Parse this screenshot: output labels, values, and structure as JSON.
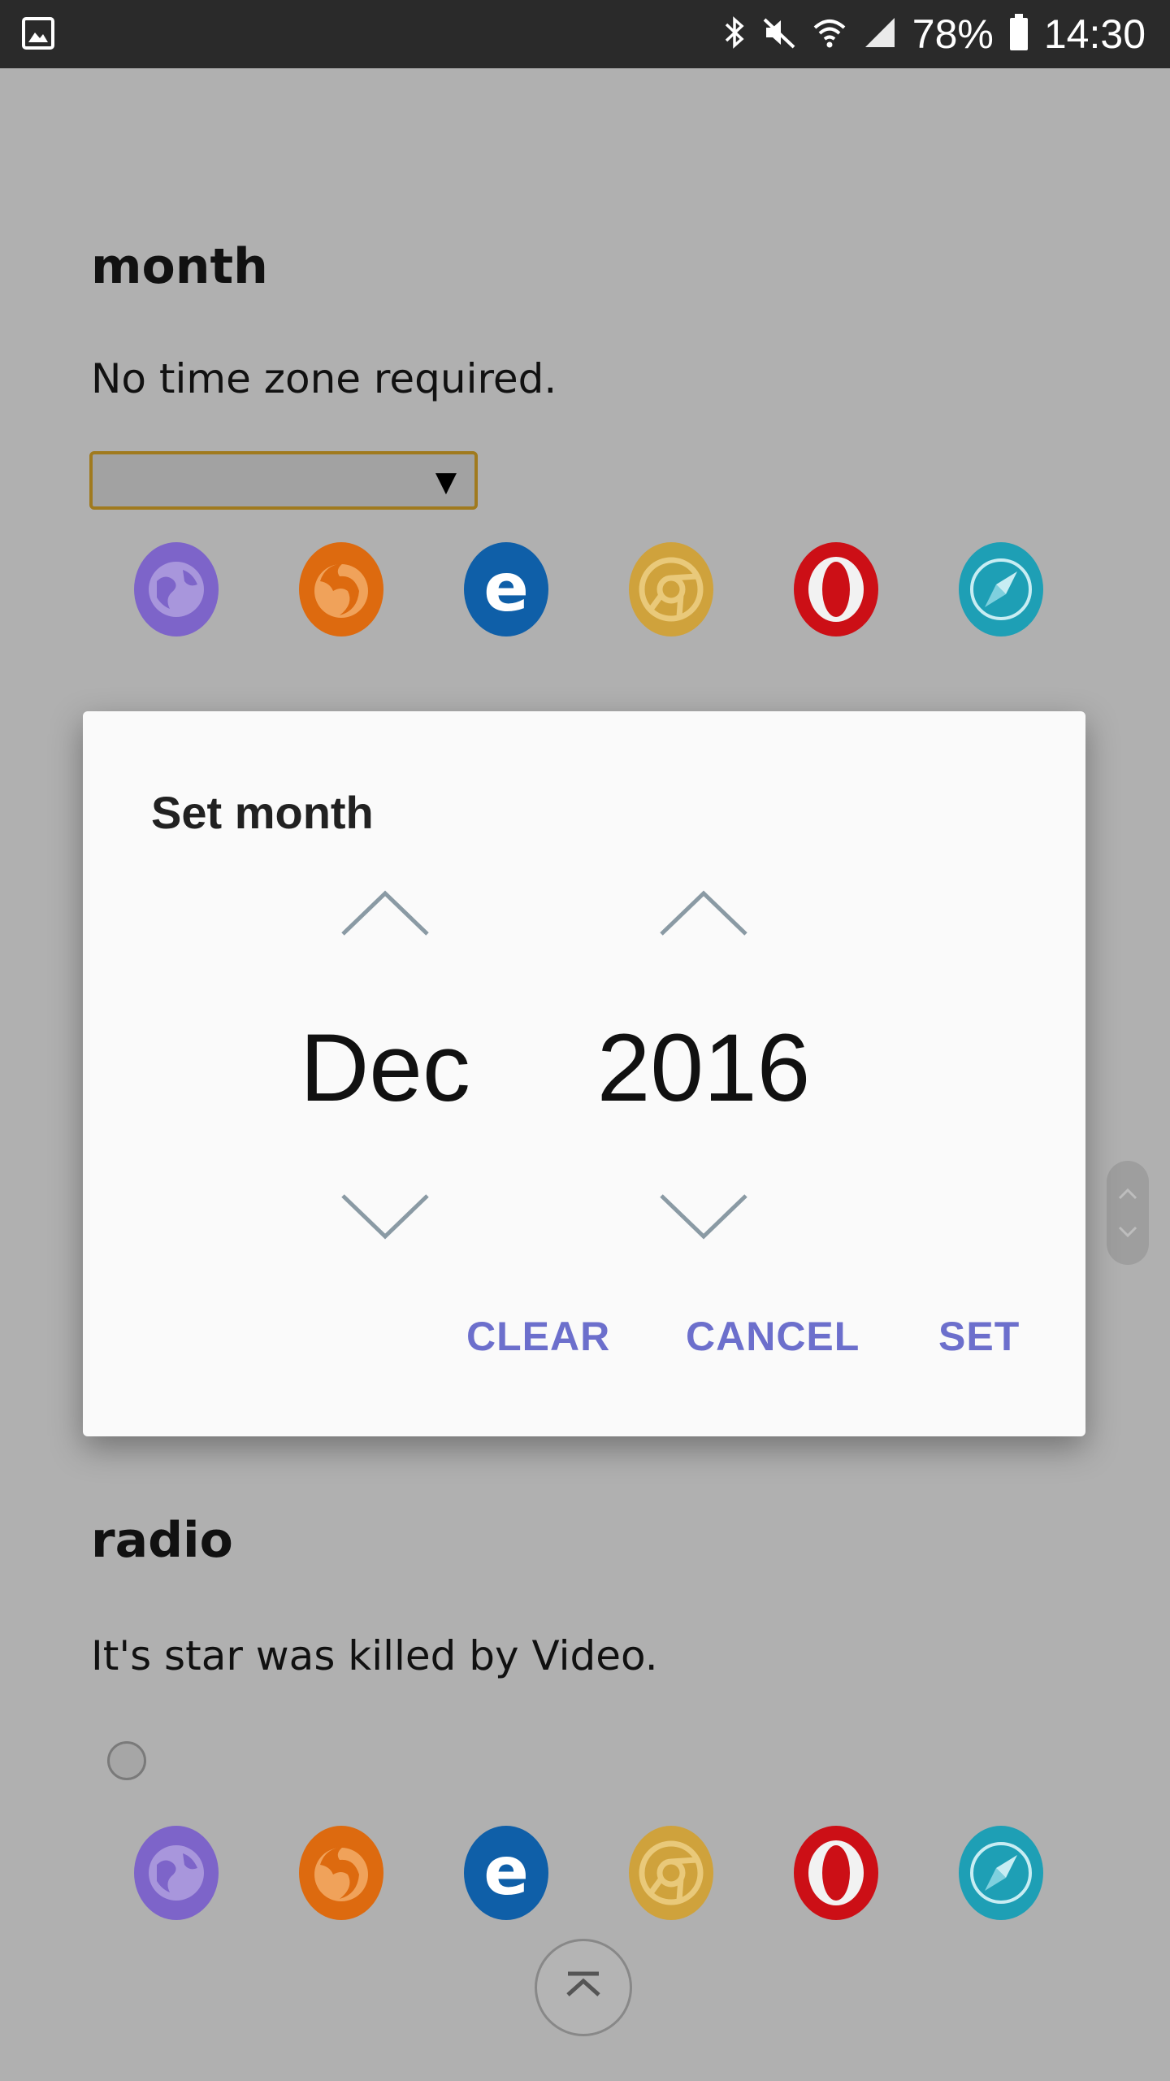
{
  "status_bar": {
    "battery": "78%",
    "time": "14:30",
    "icons": [
      "gallery-icon",
      "bluetooth-icon",
      "mute-icon",
      "wifi-icon",
      "signal-icon",
      "battery-icon"
    ]
  },
  "month_section": {
    "title": "month",
    "description": "No time zone required.",
    "select_value": "",
    "select_arrow": "▼"
  },
  "radio_section": {
    "title": "radio",
    "description": "It's star was killed by Video."
  },
  "browser_icons": [
    "browser-icon",
    "firefox-icon",
    "edge-icon",
    "chrome-icon",
    "opera-icon",
    "safari-icon"
  ],
  "colors": {
    "browser": "#7d64c9",
    "firefox": "#dd6a0f",
    "edge": "#0f5fa8",
    "chrome": "#cfa23c",
    "opera": "#cc0f16",
    "safari": "#1e9fb5",
    "accent": "#6c6fcc"
  },
  "dialog": {
    "title": "Set month",
    "month": "Dec",
    "year": "2016",
    "buttons": {
      "clear": "CLEAR",
      "cancel": "CANCEL",
      "set": "SET"
    }
  }
}
